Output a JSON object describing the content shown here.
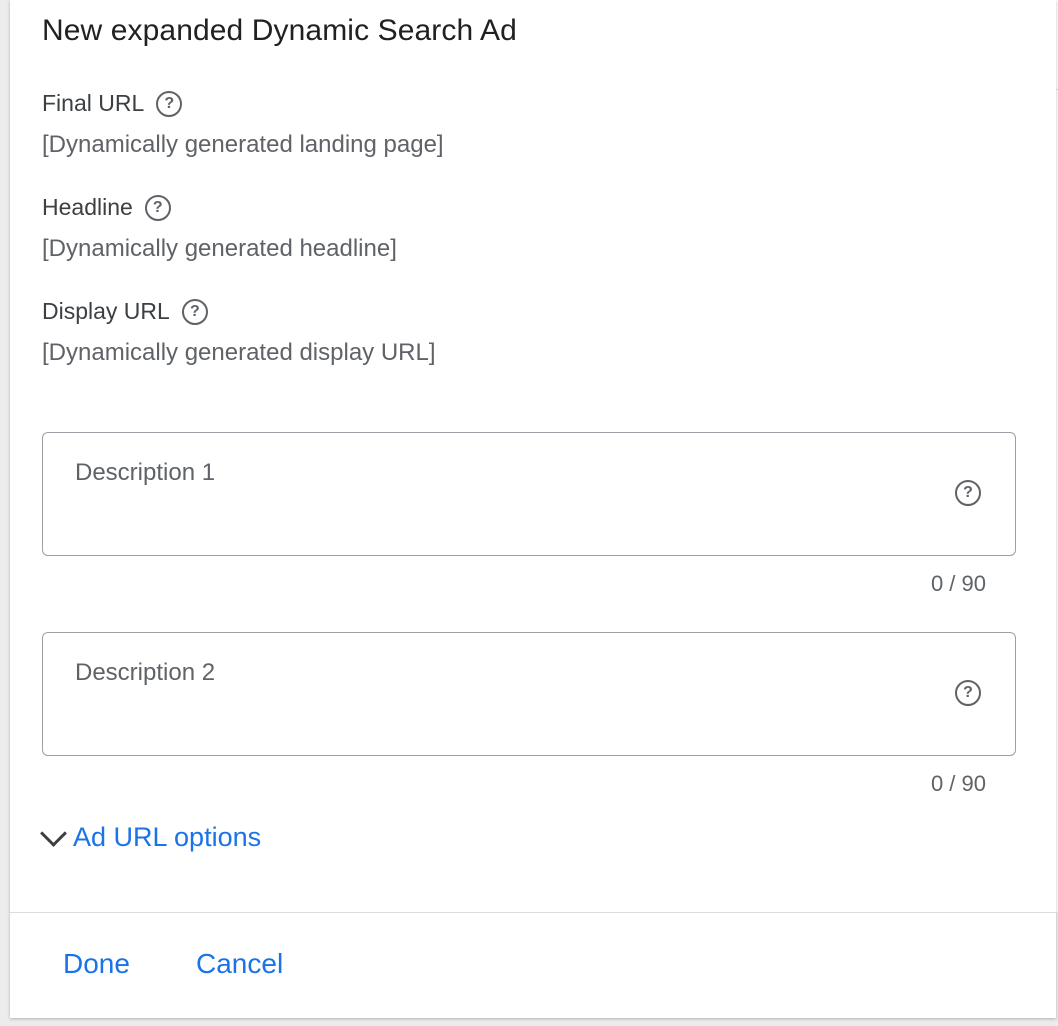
{
  "dialog": {
    "title": "New expanded Dynamic Search Ad"
  },
  "fields": {
    "final_url": {
      "label": "Final URL",
      "value": "[Dynamically generated landing page]",
      "help_icon": "question-circle"
    },
    "headline": {
      "label": "Headline",
      "value": "[Dynamically generated headline]",
      "help_icon": "question-circle"
    },
    "display_url": {
      "label": "Display URL",
      "value": "[Dynamically generated display URL]",
      "help_icon": "question-circle"
    }
  },
  "descriptions": {
    "description_1": {
      "placeholder": "Description 1",
      "value": "",
      "counter": "0 / 90",
      "help_icon": "question-circle"
    },
    "description_2": {
      "placeholder": "Description 2",
      "value": "",
      "counter": "0 / 90",
      "help_icon": "question-circle"
    }
  },
  "ad_url_options": {
    "label": "Ad URL options",
    "icon": "chevron-down"
  },
  "footer": {
    "done_label": "Done",
    "cancel_label": "Cancel"
  },
  "colors": {
    "accent": "#1a73e8",
    "text_primary": "#202124",
    "text_secondary": "#5f6368",
    "border": "#9aa0a6"
  }
}
